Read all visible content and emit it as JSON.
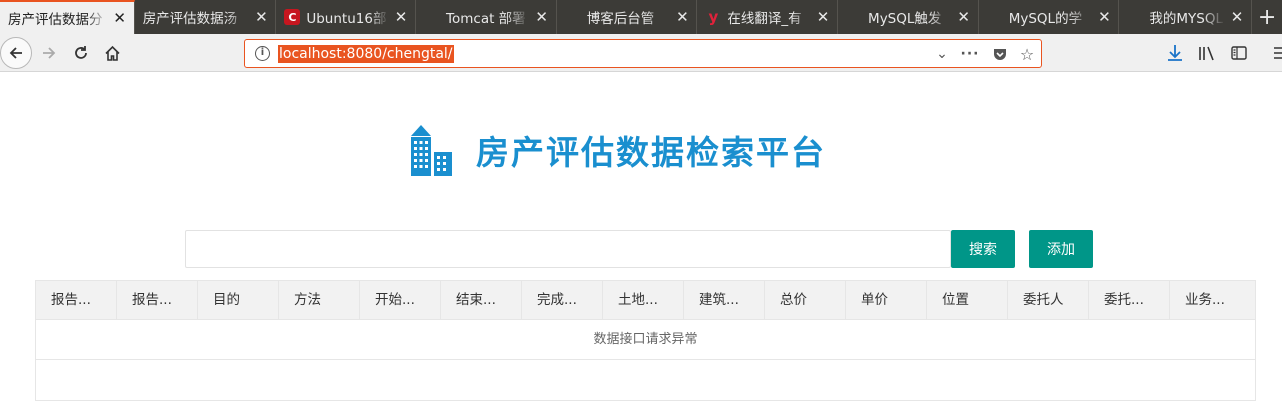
{
  "tabs": [
    {
      "title": "房产评估数据分",
      "favicon": "none",
      "active": true
    },
    {
      "title": "房产评估数据汤",
      "favicon": "none",
      "active": false
    },
    {
      "title": "Ubuntu16部",
      "favicon": "C",
      "active": false
    },
    {
      "title": "Tomcat 部署",
      "favicon": "none",
      "active": false
    },
    {
      "title": "博客后台管",
      "favicon": "none",
      "active": false
    },
    {
      "title": "在线翻译_有",
      "favicon": "y",
      "active": false
    },
    {
      "title": "MySQL触发",
      "favicon": "none",
      "active": false
    },
    {
      "title": "MySQL的学",
      "favicon": "none",
      "active": false
    },
    {
      "title": "我的MYSQL",
      "favicon": "none",
      "active": false
    }
  ],
  "toolbar": {
    "url": "localhost:8080/chengtal/",
    "accent_color": "#e95420"
  },
  "page": {
    "title": "房产评估数据检索平台",
    "brand_color": "#1a8fcf",
    "search_placeholder": "",
    "search_button": "搜索",
    "add_button": "添加",
    "button_color": "#009688"
  },
  "table": {
    "columns": [
      "报告...",
      "报告...",
      "目的",
      "方法",
      "开始...",
      "结束...",
      "完成...",
      "土地...",
      "建筑...",
      "总价",
      "单价",
      "位置",
      "委托人",
      "委托...",
      "业务..."
    ],
    "empty_message": "数据接口请求异常"
  }
}
